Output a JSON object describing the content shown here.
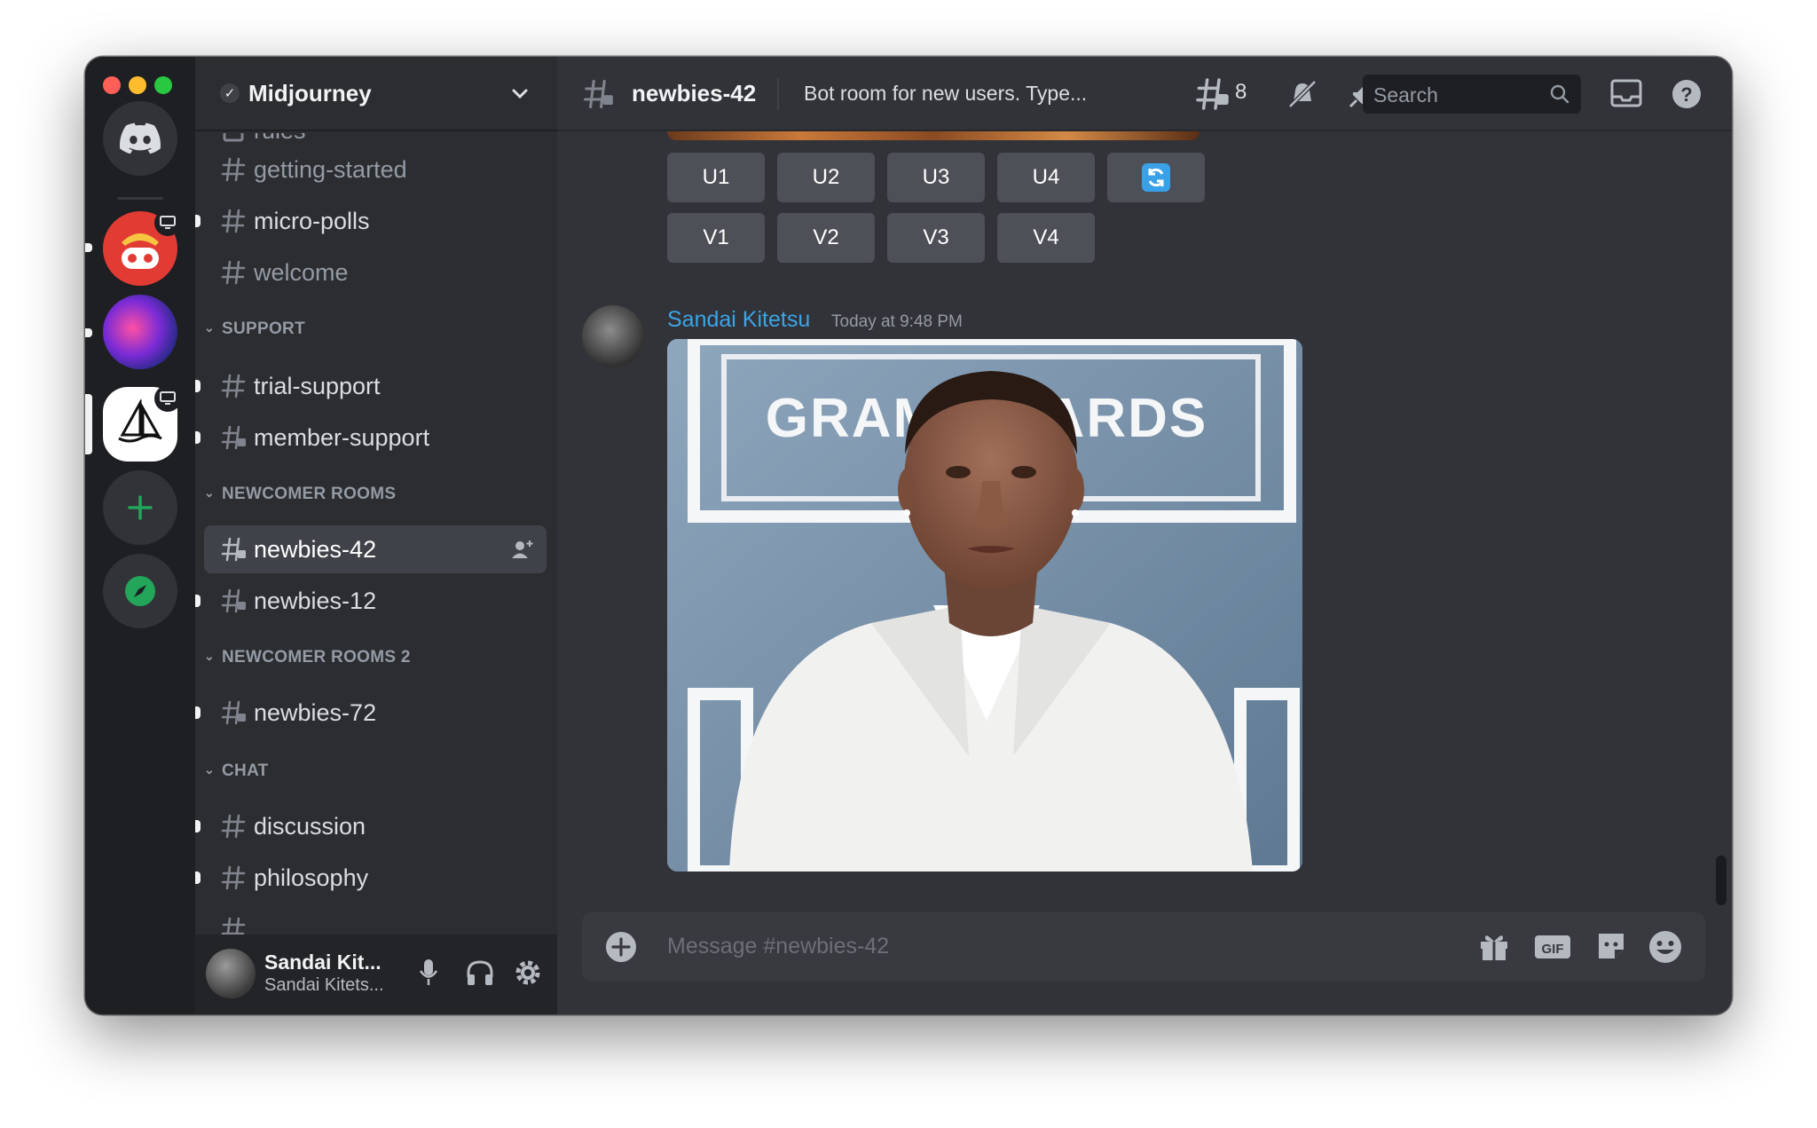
{
  "guild": {
    "name": "Midjourney"
  },
  "channels": {
    "top": [
      {
        "name": "rules"
      },
      {
        "name": "getting-started"
      },
      {
        "name": "micro-polls"
      },
      {
        "name": "welcome"
      }
    ],
    "categories": [
      {
        "label": "SUPPORT",
        "items": [
          "trial-support",
          "member-support"
        ]
      },
      {
        "label": "NEWCOMER ROOMS",
        "items": [
          "newbies-42",
          "newbies-12"
        ]
      },
      {
        "label": "NEWCOMER ROOMS 2",
        "items": [
          "newbies-72"
        ]
      },
      {
        "label": "CHAT",
        "items": [
          "discussion",
          "philosophy"
        ]
      }
    ]
  },
  "user": {
    "display_name": "Sandai Kit...",
    "tag": "Sandai Kitets..."
  },
  "header": {
    "channel": "newbies-42",
    "topic": "Bot room for new users. Type...",
    "threads_count": "8",
    "search_placeholder": "Search"
  },
  "components": {
    "upscale": [
      "U1",
      "U2",
      "U3",
      "U4"
    ],
    "variation": [
      "V1",
      "V2",
      "V3",
      "V4"
    ]
  },
  "message": {
    "author": "Sandai Kitetsu",
    "timestamp": "Today at 9:48 PM",
    "image_text": "GRAM     AWARDS"
  },
  "composer": {
    "placeholder": "Message #newbies-42"
  },
  "colors": {
    "accent_blue": "#3ba5e6",
    "green": "#23a55a",
    "background": "#313338",
    "sidebar": "#2b2d31",
    "rail": "#1e1f22"
  }
}
